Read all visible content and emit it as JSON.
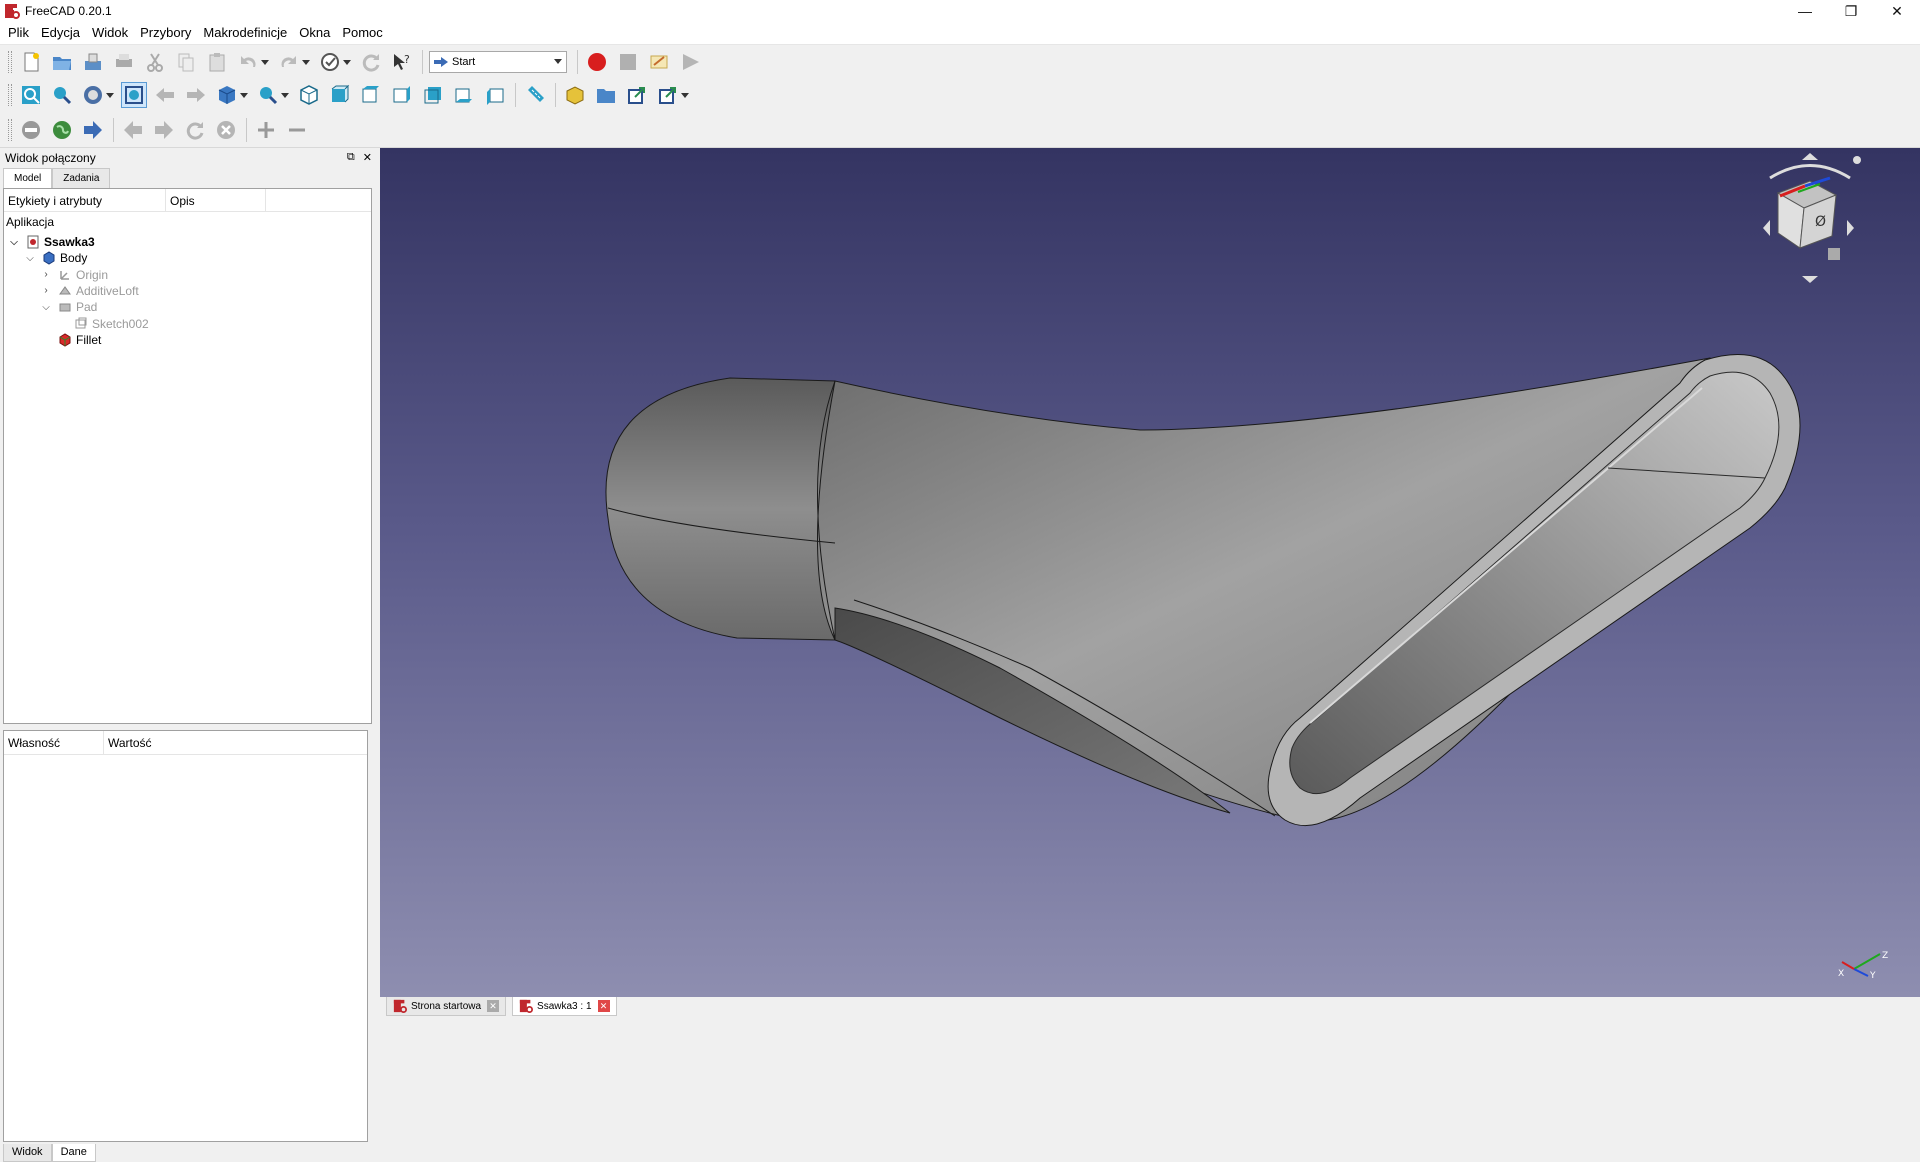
{
  "window": {
    "title": "FreeCAD 0.20.1",
    "minimize": "—",
    "maximize": "❐",
    "close": "✕"
  },
  "menu": [
    "Plik",
    "Edycja",
    "Widok",
    "Przybory",
    "Makrodefinicje",
    "Okna",
    "Pomoc"
  ],
  "toolbar": {
    "workbench_selected": "Start",
    "icons_row1": [
      "new-document-icon",
      "open-icon",
      "save-icon",
      "print-icon",
      "cut-icon",
      "copy-icon",
      "paste-icon",
      "undo-icon",
      "redo-icon",
      "refresh-icon",
      "whats-this-icon",
      "workbench-arrow-icon",
      "macro-record-icon",
      "macro-stop-icon",
      "macro-edit-icon",
      "macro-run-icon"
    ],
    "icons_row2": [
      "fit-all-icon",
      "fit-selection-icon",
      "draw-style-icon",
      "bounding-box-icon",
      "back-icon",
      "forward-icon",
      "std-views-icon",
      "zoom-icon",
      "isometric-icon",
      "front-view-icon",
      "top-view-icon",
      "right-view-icon",
      "rear-view-icon",
      "bottom-view-icon",
      "left-view-icon",
      "measure-icon",
      "part-icon",
      "group-icon",
      "link-icon",
      "link-actions-icon"
    ],
    "icons_row3": [
      "web-stop-icon",
      "web-home-icon",
      "web-go-icon",
      "web-back-icon",
      "web-next-icon",
      "web-refresh-icon",
      "web-stop2-icon",
      "zoom-in-icon",
      "zoom-out-icon"
    ]
  },
  "combo": {
    "title": "Widok połączony",
    "float_btn": "⧉",
    "close_btn": "✕",
    "tabs": [
      "Model",
      "Zadania"
    ],
    "tree_columns": [
      "Etykiety i atrybuty",
      "Opis"
    ],
    "tree_root": "Aplikacja",
    "tree": [
      {
        "label": "Ssawka3",
        "chev": "⌵",
        "depth": 0,
        "style": "bold",
        "icon": "document-icon"
      },
      {
        "label": "Body",
        "chev": "⌵",
        "depth": 1,
        "style": "normal",
        "icon": "body-icon"
      },
      {
        "label": "Origin",
        "chev": "›",
        "depth": 2,
        "style": "dim",
        "icon": "origin-icon"
      },
      {
        "label": "AdditiveLoft",
        "chev": "›",
        "depth": 2,
        "style": "dim",
        "icon": "loft-icon"
      },
      {
        "label": "Pad",
        "chev": "⌵",
        "depth": 2,
        "style": "dim",
        "icon": "pad-icon"
      },
      {
        "label": "Sketch002",
        "chev": "",
        "depth": 3,
        "style": "dim",
        "icon": "sketch-icon"
      },
      {
        "label": "Fillet",
        "chev": "",
        "depth": 2,
        "style": "normal",
        "icon": "fillet-icon"
      }
    ],
    "prop_columns": [
      "Własność",
      "Wartość"
    ],
    "bottom_tabs": [
      "Widok",
      "Dane"
    ]
  },
  "navcube": {
    "face_label": "Ø",
    "axis_x": "X",
    "axis_y": "Y",
    "axis_z": "Z"
  },
  "doc_tabs": [
    {
      "label": "Strona startowa",
      "active": false
    },
    {
      "label": "Ssawka3 : 1",
      "active": true
    }
  ],
  "colors": {
    "viewport_top": "#343462",
    "viewport_bottom": "#8e8eb0",
    "model_gray": "#8a8a8a"
  }
}
